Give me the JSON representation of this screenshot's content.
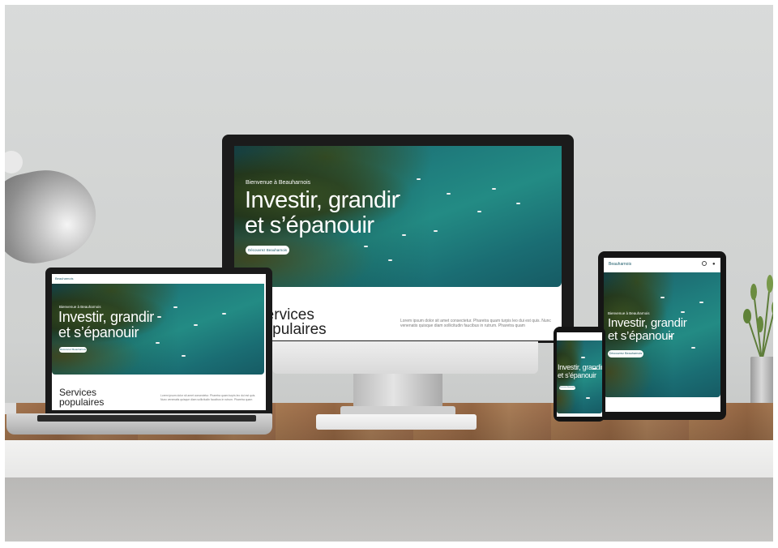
{
  "site": {
    "welcome": "Bienvenue à Beauharnois",
    "headline_line1": "Investir, grandir",
    "headline_line2": "et s’épanouir",
    "cta_label": "Découvrez Beauharnois",
    "services_line1": "Services",
    "services_line2": "populaires",
    "services_body": "Lorem ipsum dolor sit amet consectetur. Pharetra quam turpis leo dui est quis. Nunc venenatis quisque diam sollicitudin faucibus in rutrum. Pharetra quam",
    "brand": "Beauharnois"
  },
  "devices": [
    "monitor",
    "laptop",
    "tablet",
    "phone"
  ],
  "colors": {
    "brand_teal": "#1d5c6a",
    "water": "#1f7d7d"
  },
  "icons": {
    "tablet_header": [
      "search-icon",
      "menu-icon"
    ]
  }
}
